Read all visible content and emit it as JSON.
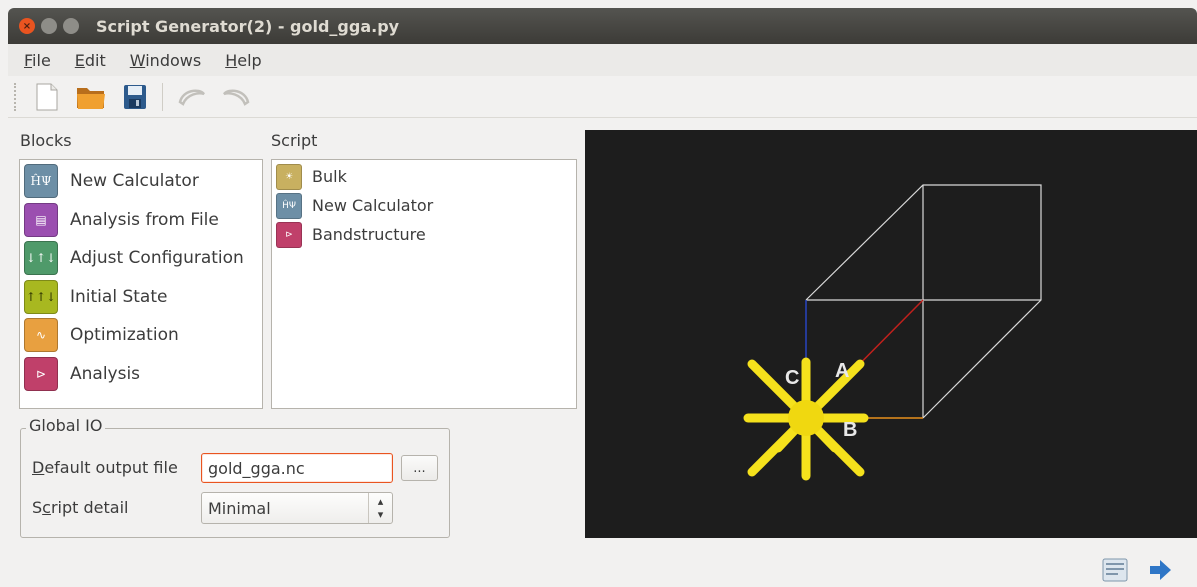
{
  "window": {
    "title": "Script Generator(2) - gold_gga.py"
  },
  "menu": {
    "items": [
      {
        "label": "File",
        "mnemonic": "F",
        "rest": "ile"
      },
      {
        "label": "Edit",
        "mnemonic": "E",
        "rest": "dit"
      },
      {
        "label": "Windows",
        "mnemonic": "W",
        "rest": "indows"
      },
      {
        "label": "Help",
        "mnemonic": "H",
        "rest": "elp"
      }
    ]
  },
  "toolbar": {
    "icons": [
      "new-file-icon",
      "open-folder-icon",
      "save-icon",
      "undo-icon",
      "redo-icon"
    ]
  },
  "blocks": {
    "heading": "Blocks",
    "items": [
      {
        "label": "New Calculator",
        "icon": "calculator-icon",
        "glyph": "ĤΨ",
        "color": "#6d8fa6"
      },
      {
        "label": "Analysis from File",
        "icon": "analysis-file-icon",
        "glyph": "▤",
        "color": "#9b4fb0"
      },
      {
        "label": "Adjust Configuration",
        "icon": "adjust-configuration-icon",
        "glyph": "↓↑↓",
        "color": "#4f9a6a"
      },
      {
        "label": "Initial State",
        "icon": "initial-state-icon",
        "glyph": "↑↑↓",
        "color": "#a8b820"
      },
      {
        "label": "Optimization",
        "icon": "optimization-icon",
        "glyph": "∿",
        "color": "#e8a040"
      },
      {
        "label": "Analysis",
        "icon": "analysis-icon",
        "glyph": "⊳",
        "color": "#c0406a"
      }
    ]
  },
  "script": {
    "heading": "Script",
    "items": [
      {
        "label": "Bulk",
        "icon": "bulk-icon",
        "glyph": "☀",
        "color": "#c8b060"
      },
      {
        "label": "New Calculator",
        "icon": "calculator-icon",
        "glyph": "ĤΨ",
        "color": "#6d8fa6"
      },
      {
        "label": "Bandstructure",
        "icon": "bandstructure-icon",
        "glyph": "⊳",
        "color": "#c0406a"
      }
    ]
  },
  "global_io": {
    "title": "Global IO",
    "output_file": {
      "label_mnemonic": "D",
      "label_rest": "efault output file",
      "value": "gold_gga.nc"
    },
    "browse_label": "...",
    "script_detail": {
      "label_pre": "S",
      "label_mnemonic": "c",
      "label_rest": "ript detail",
      "value": "Minimal"
    }
  },
  "viewer": {
    "axis_labels": {
      "a": "A",
      "b": "B",
      "c": "C"
    },
    "colors": {
      "background": "#1d1d1d",
      "cell": "#d9d9d9",
      "atom": "#f5e11c",
      "axis_a": "#c0201c",
      "axis_b": "#e8901c",
      "axis_c": "#2844c0"
    }
  },
  "bottom": {
    "icons": [
      "log-icon",
      "send-arrow-icon"
    ]
  }
}
